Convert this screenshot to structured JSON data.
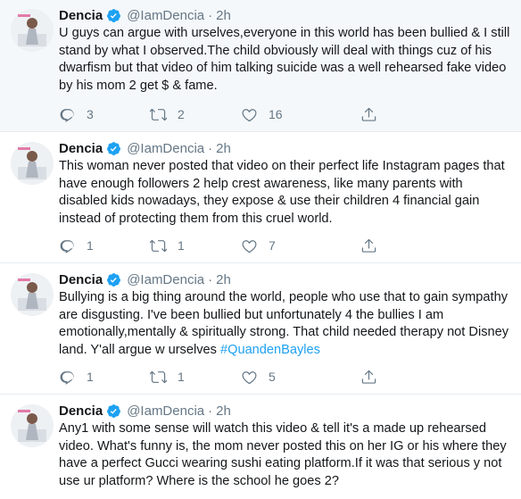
{
  "tweets": [
    {
      "name": "Dencia",
      "handle": "@IamDencia",
      "dot": "·",
      "time": "2h",
      "text": "U guys can argue with urselves,everyone in this world has been bullied & I still stand by what I observed.The child obviously will deal with things cuz of his dwarfism but that video of him talking suicide was a well rehearsed fake video by his mom 2 get $ & fame.",
      "hashtag": "",
      "replies": "3",
      "retweets": "2",
      "likes": "16"
    },
    {
      "name": "Dencia",
      "handle": "@IamDencia",
      "dot": "·",
      "time": "2h",
      "text": "This woman never posted that video on their perfect life Instagram pages that have enough followers 2 help crest awareness, like many parents with disabled kids nowadays, they expose & use their children 4 financial gain instead of protecting them from this cruel world.",
      "hashtag": "",
      "replies": "1",
      "retweets": "1",
      "likes": "7"
    },
    {
      "name": "Dencia",
      "handle": "@IamDencia",
      "dot": "·",
      "time": "2h",
      "text": "Bullying is a big thing around the world, people who use that to gain sympathy are disgusting. I've been bullied but unfortunately 4 the bullies I am emotionally,mentally & spiritually strong. That child needed therapy not Disney land. Y'all argue w urselves ",
      "hashtag": "#QuandenBayles",
      "replies": "1",
      "retweets": "1",
      "likes": "5"
    },
    {
      "name": "Dencia",
      "handle": "@IamDencia",
      "dot": "·",
      "time": "2h",
      "text": "Any1 with some sense will watch this video & tell it's a made up rehearsed video. What's funny is, the mom never posted this on her IG or his where they have a perfect Gucci wearing sushi eating platform.If it was that serious y not use ur platform? Where is the school he goes 2?",
      "hashtag": ""
    }
  ],
  "colors": {
    "accent": "#1da1f2",
    "muted": "#657786",
    "text": "#14171a",
    "highlight_bg": "#f5f8fa",
    "divider": "#e6ecf0"
  },
  "icons": [
    "avatar-image",
    "verified-badge-icon",
    "reply-icon",
    "retweet-icon",
    "like-icon",
    "share-icon"
  ]
}
